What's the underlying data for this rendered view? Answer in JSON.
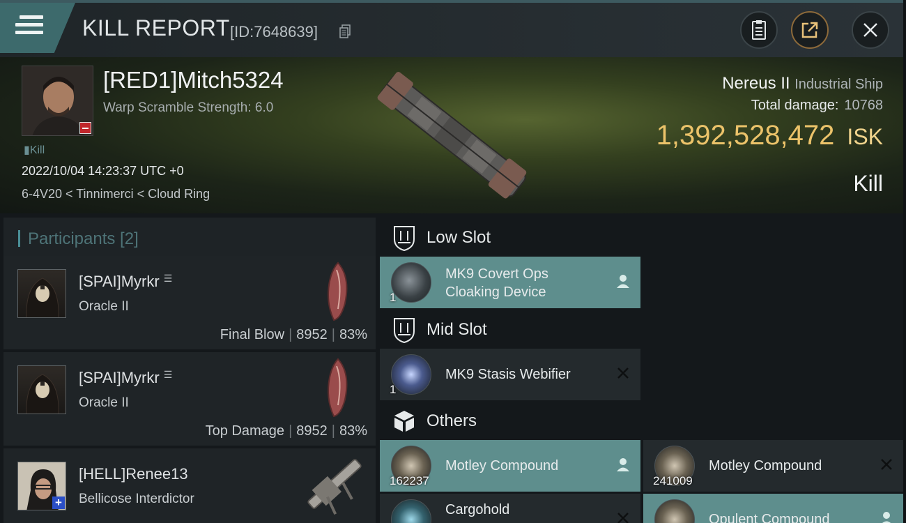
{
  "header": {
    "title": "KILL REPORT",
    "kill_id": "[ID:7648639]"
  },
  "victim": {
    "name": "[RED1]Mitch5324",
    "warp_scramble": "Warp Scramble Strength: 6.0",
    "tag": "Kill",
    "datetime": "2022/10/04 14:23:37 UTC +0",
    "location": "6-4V20 < Tinnimerci < Cloud Ring"
  },
  "ship": {
    "name": "Nereus II",
    "class": "Industrial Ship",
    "total_damage_label": "Total damage:",
    "total_damage": "10768",
    "isk_value": "1,392,528,472",
    "isk_unit": "ISK",
    "kill_type": "Kill"
  },
  "participants": {
    "header": "Participants [2]",
    "rows": [
      {
        "name": "[SPAI]Myrkr",
        "ship": "Oracle II",
        "role": "Final Blow",
        "damage": "8952",
        "percent": "83%"
      },
      {
        "name": "[SPAI]Myrkr",
        "ship": "Oracle II",
        "role": "Top Damage",
        "damage": "8952",
        "percent": "83%"
      },
      {
        "name": "[HELL]Renee13",
        "ship": "Bellicose Interdictor"
      }
    ]
  },
  "slots": {
    "low": {
      "label": "Low Slot",
      "items": [
        {
          "name_line1": "MK9 Covert Ops",
          "name_line2": "Cloaking Device",
          "qty": "1",
          "status": "dropped"
        }
      ]
    },
    "mid": {
      "label": "Mid Slot",
      "items": [
        {
          "name": "MK9 Stasis Webifier",
          "qty": "1",
          "status": "destroyed"
        }
      ]
    },
    "others": {
      "label": "Others",
      "items": [
        {
          "name": "Motley Compound",
          "qty": "162237",
          "status": "dropped"
        },
        {
          "name": "Motley Compound",
          "qty": "241009",
          "status": "destroyed"
        },
        {
          "name": "Cargohold",
          "status": "destroyed"
        },
        {
          "name": "Opulent Compound",
          "status": "dropped"
        }
      ]
    }
  },
  "colors": {
    "accent": "#4a8f97",
    "dropped": "#5e8e8d",
    "isk": "#ecc36a"
  },
  "icons": {
    "menu": "hamburger-icon",
    "copy": "copy-icon",
    "clipboard": "clipboard-icon",
    "share": "share-icon",
    "close": "close-icon",
    "slot": "shield-slot-icon",
    "others": "cube-icon",
    "dropped": "person-icon",
    "destroyed": "x-mark-icon"
  }
}
